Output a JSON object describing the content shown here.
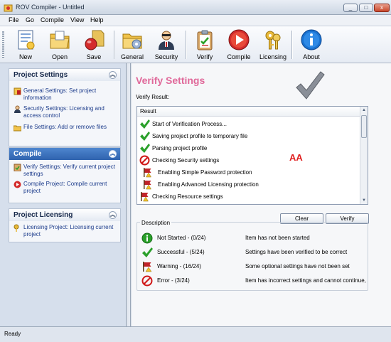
{
  "window": {
    "title": "ROV Compiler - Untitled",
    "controls": {
      "minimize": "_",
      "maximize": "□",
      "close": "x"
    }
  },
  "menu": [
    "File",
    "Go",
    "Compile",
    "View",
    "Help"
  ],
  "toolbar": {
    "buttons": [
      {
        "label": "New",
        "icon": "new-document-icon"
      },
      {
        "label": "Open",
        "icon": "open-folder-icon"
      },
      {
        "label": "Save",
        "icon": "save-icon"
      },
      {
        "label": "General",
        "icon": "general-folder-icon"
      },
      {
        "label": "Security",
        "icon": "security-icon"
      },
      {
        "label": "Verify",
        "icon": "verify-clipboard-icon"
      },
      {
        "label": "Compile",
        "icon": "compile-play-icon"
      },
      {
        "label": "Licensing",
        "icon": "licensing-keys-icon"
      },
      {
        "label": "About",
        "icon": "about-info-icon"
      }
    ]
  },
  "sidebar": {
    "panels": [
      {
        "title": "Project Settings",
        "active": false,
        "items": [
          {
            "text": "General Settings: Set project information",
            "icon": "general-settings-icon"
          },
          {
            "text": "Security Settings: Licensing and access control",
            "icon": "security-settings-icon"
          },
          {
            "text": "File Settings: Add or remove files",
            "icon": "file-settings-icon"
          }
        ]
      },
      {
        "title": "Compile",
        "active": true,
        "items": [
          {
            "text": "Verify Settings: Verify current project settings",
            "icon": "verify-settings-icon"
          },
          {
            "text": "Compile Project: Compile current project",
            "icon": "compile-project-icon"
          }
        ]
      },
      {
        "title": "Project Licensing",
        "active": false,
        "items": [
          {
            "text": "Licensing Project: Licensing current project",
            "icon": "licensing-project-icon"
          }
        ]
      }
    ]
  },
  "main": {
    "title": "Verify Settings",
    "verify_result_label": "Verify Result:",
    "results_header": "Result",
    "results": [
      {
        "text": "Start of Verification Process...",
        "status": "success",
        "indent": false
      },
      {
        "text": "Saving project profile to temporary file",
        "status": "success",
        "indent": false
      },
      {
        "text": "Parsing project profile",
        "status": "success",
        "indent": false
      },
      {
        "text": "Checking Security settings",
        "status": "error",
        "indent": false
      },
      {
        "text": "Enabling Simple Password protection",
        "status": "warning",
        "indent": true
      },
      {
        "text": "Enabling Advanced Licensing protection",
        "status": "warning",
        "indent": true
      },
      {
        "text": "Checking Resource settings",
        "status": "warning",
        "indent": false
      }
    ],
    "annotation": "AA",
    "clear_label": "Clear",
    "verify_label": "Verify",
    "description_label": "Description",
    "legend": [
      {
        "name": "Not Started - (0/24)",
        "text": "Item has not been started",
        "status": "not-started"
      },
      {
        "name": "Successful - (5/24)",
        "text": "Settings have been verified to be correct",
        "status": "success"
      },
      {
        "name": "Warning - (16/24)",
        "text": "Some optional settings have not been set",
        "status": "warning"
      },
      {
        "name": "Error - (3/24)",
        "text": "Item has incorrect settings and cannot continue,",
        "status": "error"
      }
    ]
  },
  "status": {
    "text": "Ready"
  },
  "colors": {
    "accent_title": "#e0699a",
    "link": "#1a3a8a",
    "active_panel": "#2f63ae",
    "success": "#2aa02a",
    "error": "#d01818",
    "info": "#1a73d1"
  }
}
